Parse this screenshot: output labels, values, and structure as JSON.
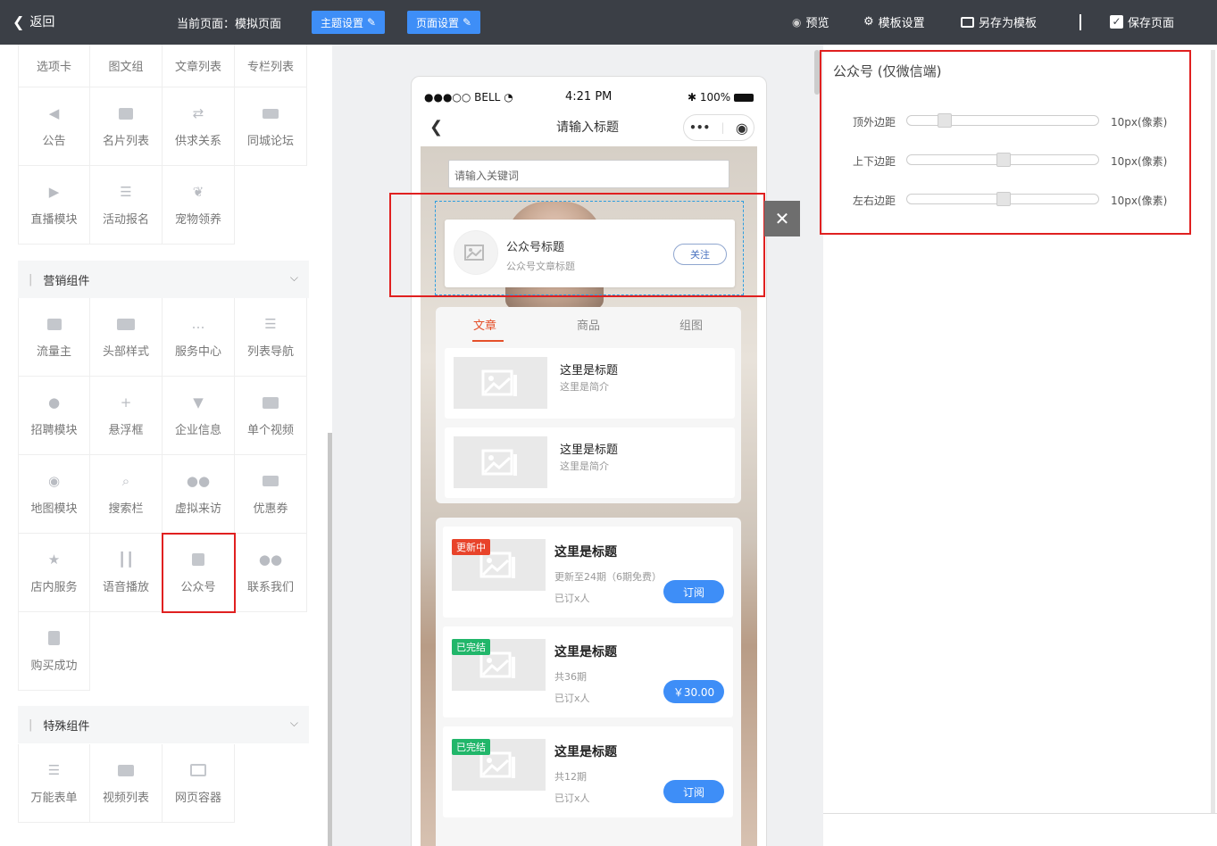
{
  "topbar": {
    "back_label": "返回",
    "current_page": "当前页面：模拟页面",
    "theme_btn": "主题设置",
    "page_btn": "页面设置",
    "preview": "预览",
    "template_settings": "模板设置",
    "save_as_template": "另存为模板",
    "save_page": "保存页面",
    "colors": {
      "bar": "#3b3f46",
      "button": "#3e8ef7"
    }
  },
  "left": {
    "top_row": [
      "选项卡",
      "图文组",
      "文章列表",
      "专栏列表"
    ],
    "basic_items": [
      "公告",
      "名片列表",
      "供求关系",
      "同城论坛",
      "直播模块",
      "活动报名",
      "宠物领养"
    ],
    "marketing_title": "营销组件",
    "marketing_items": [
      "流量主",
      "头部样式",
      "服务中心",
      "列表导航",
      "招聘模块",
      "悬浮框",
      "企业信息",
      "单个视频",
      "地图模块",
      "搜索栏",
      "虚拟来访",
      "优惠券",
      "店内服务",
      "语音播放",
      "公众号",
      "联系我们",
      "购买成功"
    ],
    "special_title": "特殊组件",
    "special_items": [
      "万能表单",
      "视频列表",
      "网页容器"
    ]
  },
  "phone": {
    "carrier": "●●●○○ BELL",
    "time": "4:21 PM",
    "battery": "100%",
    "nav_title": "请输入标题",
    "search_placeholder": "请输入关键词",
    "gzh_title": "公众号标题",
    "gzh_sub": "公众号文章标题",
    "follow": "关注",
    "tabs": [
      "文章",
      "商品",
      "组图"
    ],
    "articles": [
      {
        "title": "这里是标题",
        "desc": "这里是简介"
      },
      {
        "title": "这里是标题",
        "desc": "这里是简介"
      }
    ],
    "columns": [
      {
        "badge": "更新中",
        "title": "这里是标题",
        "line1": "更新至24期（6期免费）",
        "line2": "已订x人",
        "button": "订阅"
      },
      {
        "badge": "已完结",
        "title": "这里是标题",
        "line1": "共36期",
        "line2": "已订x人",
        "button": "￥30.00"
      },
      {
        "badge": "已完结",
        "title": "这里是标题",
        "line1": "共12期",
        "line2": "已订x人",
        "button": "订阅"
      }
    ]
  },
  "right": {
    "title": "公众号 (仅微信端)",
    "rows": [
      {
        "label": "顶外边距",
        "value": "10px(像素)"
      },
      {
        "label": "上下边距",
        "value": "10px(像素)"
      },
      {
        "label": "左右边距",
        "value": "10px(像素)"
      }
    ]
  }
}
